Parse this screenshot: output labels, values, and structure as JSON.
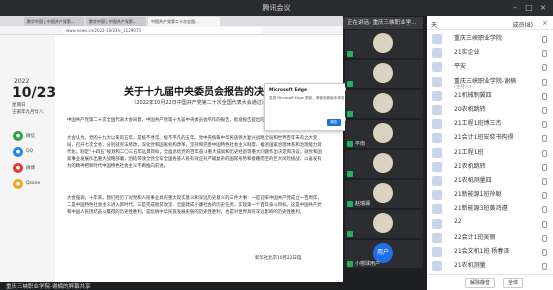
{
  "window": {
    "title": "腾讯会议",
    "speaking": "正在讲话: 重庆三峡职业学..."
  },
  "share": {
    "tabs": [
      "数字中国 | 中国共产党第...",
      "数字中国 | 中国共产党第...",
      "中国共产党第二十次全国..."
    ],
    "address": "www.news.cn/2022-10/23/c_1129075",
    "year": "2022",
    "date": "10/23",
    "weekday": "星期日",
    "lunar": "壬寅年九月廿八",
    "sidebar_apps": [
      {
        "label": "微信",
        "color": "#2ba245",
        "icon": "wechat-icon"
      },
      {
        "label": "QQ",
        "color": "#1e88e5",
        "icon": "qq-icon"
      },
      {
        "label": "微博",
        "color": "#e53935",
        "icon": "weibo-icon"
      },
      {
        "label": "Qzone",
        "color": "#f6a623",
        "icon": "qzone-icon"
      }
    ],
    "doc_title": "关于十九届中央委员会报告的决议",
    "doc_sub": "（2022年10月22日中国共产党第二十次全国代表大会通过）",
    "paragraphs": [
      "中国共产党第二十次全国代表大会同意，中国共产党第十九届中央委员会所作的报告，批准报告提出的各项任务和举措。",
      "大会认为，党的十九大以来的五年，是极不寻常、极不平凡的五年。党中央统筹中华民族伟大复兴战略全局和世界百年未有之大变局，召开七次全会，分别就宪法修改，深化党和国家机构改革，坚持和完善中国特色社会主义制度、推进国家治理体系和治理能力现代化，制定“十四五”规划和二〇三五年远景目标，全面总结党的百年奋斗重大成就和历史经验等重大问题作出决定和决议，就党和国家事业发展作出重大战略部署，团结带领全党全军全国各族人民有效应对严峻复杂的国际形势和接踵而至的巨大风险挑战，以奋发有为的精神把新时代中国特色社会主义不断推向前进。",
      "大会强调，十年来，我们经历了对党和人民事业具有重大现实意义和深远历史意义的三件大事：一是迎来中国共产党成立一百周年，二是中国特色社会主义进入新时代，三是完成脱贫攻坚、全面建成小康社会的历史任务，实现第一个百年奋斗目标。这是中国共产党和中国人民团结奋斗赢得的历史性胜利，是彪炳中华民族发展史册的历史性胜利，也是对世界具有深远影响的历史性胜利。"
    ],
    "signature": "新华社北京10月22日电",
    "popup": {
      "title": "Microsoft Edge",
      "text": "发现 Microsoft Edge 更新，请使用新版本体验。",
      "button": "确定"
    },
    "presenter": "重庆三峡职业学院-谢楠的屏幕共享"
  },
  "tiles": [
    {
      "name": "",
      "color": ""
    },
    {
      "name": "",
      "color": ""
    },
    {
      "name": "",
      "color": ""
    },
    {
      "name": "平南",
      "color": ""
    },
    {
      "name": "",
      "color": ""
    },
    {
      "name": "赵瑞澜",
      "color": ""
    },
    {
      "name": "",
      "color": ""
    },
    {
      "name": "小榕球用户",
      "color": "blue",
      "avatar_text": "用户"
    },
    {
      "name": "",
      "color": ""
    },
    {
      "name": "肖毅",
      "color": ""
    }
  ],
  "panel": {
    "tab": "天",
    "count_label": "成员(8)",
    "members": [
      {
        "name": "重庆三峡职业学院",
        "role": ""
      },
      {
        "name": "21实企业",
        "role": ""
      },
      {
        "name": "平安",
        "role": ""
      },
      {
        "name": "重庆三峡职业学院-谢楠",
        "role": "(主持人)"
      },
      {
        "name": "21机械制冀四",
        "role": ""
      },
      {
        "name": "20农机跳转",
        "role": ""
      },
      {
        "name": "21工程1班博三杰",
        "role": ""
      },
      {
        "name": "21会计1班安奕书构得",
        "role": ""
      },
      {
        "name": "21工程1班",
        "role": ""
      },
      {
        "name": "21农机跳转",
        "role": ""
      },
      {
        "name": "21农机测量四",
        "role": ""
      },
      {
        "name": "21新能源1班孙聪",
        "role": ""
      },
      {
        "name": "21新能源3班黄鸿遵",
        "role": ""
      },
      {
        "name": "22",
        "role": ""
      },
      {
        "name": "22会计1班吴丽",
        "role": ""
      },
      {
        "name": "21会文机1班 杨春泽",
        "role": ""
      },
      {
        "name": "21农机测量",
        "role": ""
      }
    ],
    "footer": {
      "mute_all": "解除静音",
      "more": "全体"
    }
  }
}
